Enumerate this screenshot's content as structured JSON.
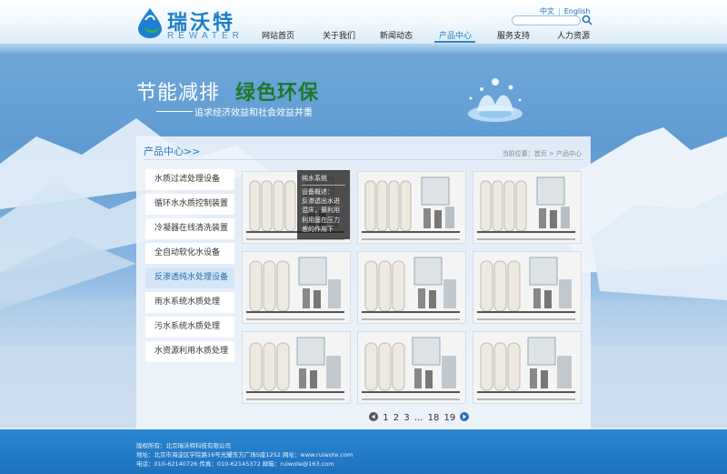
{
  "header": {
    "logo_cn": "瑞沃特",
    "logo_en": "REWATER",
    "lang_cn": "中文",
    "lang_sep": "|",
    "lang_en": "English",
    "search": {
      "value": ""
    }
  },
  "nav": {
    "items": [
      {
        "label": "网站首页"
      },
      {
        "label": "关于我们"
      },
      {
        "label": "新闻动态"
      },
      {
        "label": "产品中心",
        "active": true
      },
      {
        "label": "服务支持"
      },
      {
        "label": "人力资源"
      }
    ]
  },
  "banner": {
    "slogan_white": "节能减排",
    "slogan_green": "绿色环保",
    "subtitle": "追求经济效益和社会效益并重"
  },
  "panel": {
    "title": "产品中心>>",
    "breadcrumb": "当前位置：首页 > 产品中心"
  },
  "sidebar": {
    "items": [
      {
        "label": "水质过滤处理设备"
      },
      {
        "label": "循环水水质控制装置"
      },
      {
        "label": "冷凝器在线清洗装置"
      },
      {
        "label": "全自动软化水设备"
      },
      {
        "label": "反渗透纯水处理设备",
        "active": true
      },
      {
        "label": "雨水系统水质处理"
      },
      {
        "label": "污水系统水质处理"
      },
      {
        "label": "水资源利用水质处理"
      }
    ]
  },
  "tooltip": {
    "title": "纯水系统",
    "line1": "设备概述：",
    "line2": "反渗透出水进",
    "line3": "混床，最利用",
    "line4": "利用膜在压力",
    "line5": "差的作用下"
  },
  "pagination": {
    "p1": "1",
    "p2": "2",
    "p3": "3",
    "dots": "...",
    "p18": "18",
    "p19": "19"
  },
  "footer": {
    "line1": "版权所有：北京瑞沃特科技有限公司",
    "line2": "地址：北京市海淀区学院路16号光耀东方广场S座1252    网址：www.ruiwote.com",
    "line3": "电话：010-62140726    传真：010-62145372    邮箱：ruiwote@163.com"
  },
  "colors": {
    "accent": "#2379c0",
    "slogan_green": "#1a7a2a",
    "footer_bg": "#1d72c0"
  }
}
